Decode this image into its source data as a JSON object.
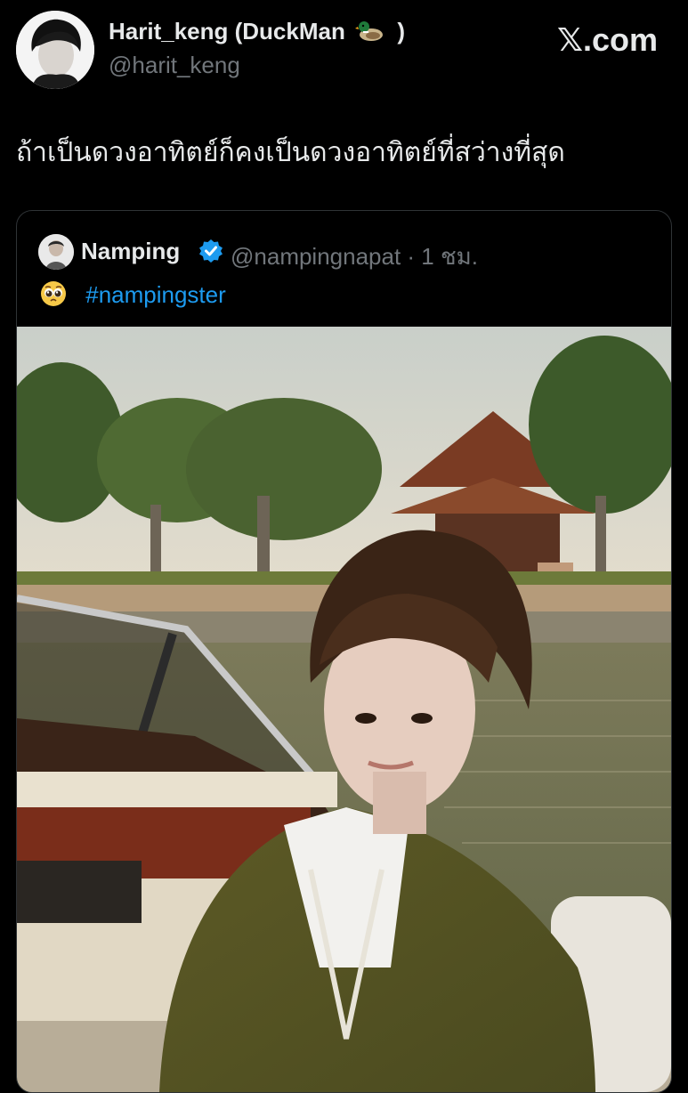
{
  "author": {
    "display_name": "Harit_keng (DuckMan",
    "display_name_suffix": ")",
    "handle": "@harit_keng",
    "badge_icon": "duck-emoji-icon"
  },
  "brand": "𝕏.com",
  "tweet": {
    "text": "ถ้าเป็นดวงอาทิตย์ก็คงเป็นดวงอาทิตย์ที่สว่างที่สุด"
  },
  "quoted_tweet": {
    "display_name": "Namping",
    "verified_icon": "verified-badge-icon",
    "handle_and_time": "@nampingnapat · 1 ชม.",
    "emoji_icon": "pleading-face-emoji-icon",
    "hashtag": "#nampingster",
    "media": "photo-person-on-boat"
  },
  "colors": {
    "background": "#000000",
    "text_primary": "#e7e9ea",
    "text_secondary": "#71767b",
    "link": "#1d9bf0",
    "verified": "#1d9bf0",
    "card_border": "#2f3336"
  }
}
